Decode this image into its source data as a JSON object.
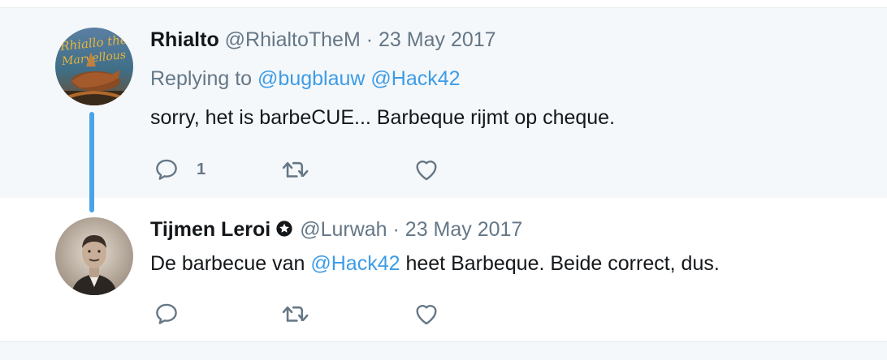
{
  "tweets": [
    {
      "fullname": "Rhialto",
      "handle": "@RhialtoTheM",
      "separator": "·",
      "date": "23 May 2017",
      "replying_prefix": "Replying to",
      "replying_to": [
        "@bugblauw",
        "@Hack42"
      ],
      "text": "sorry, het is barbeCUE... Barbeque rijmt op cheque.",
      "reply_count": "1",
      "avatar_icon": "rhialto-avatar",
      "avatar_caption": "Rhialto the Marvellous"
    },
    {
      "fullname": "Tijmen Leroi",
      "handle": "@Lurwah",
      "separator": "·",
      "date": "23 May 2017",
      "text_before": "De barbecue van ",
      "text_mention": "@Hack42",
      "text_after": " heet Barbeque. Beide correct, dus.",
      "reply_count": "",
      "avatar_icon": "portrait-avatar"
    }
  ],
  "icons": {
    "reply": "reply-icon",
    "retweet": "retweet-icon",
    "like": "heart-icon",
    "verified": "verified-badge-icon"
  },
  "colors": {
    "thread_line": "#4aa3e8",
    "link": "#3d9ce6",
    "icon": "#657786",
    "text": "#14171a"
  }
}
